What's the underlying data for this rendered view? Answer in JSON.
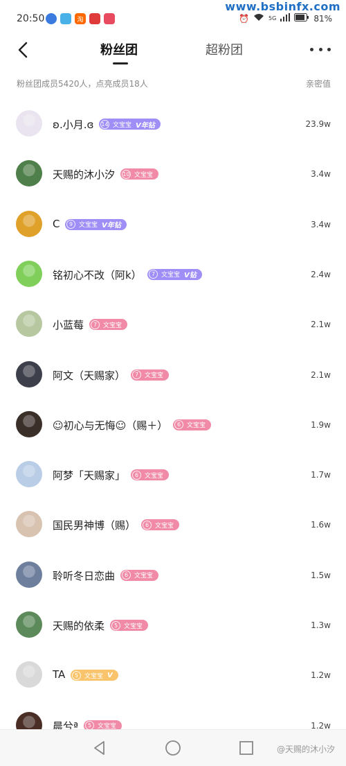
{
  "status_bar": {
    "time": "20:50",
    "network": "5G",
    "battery": "81%",
    "watermark": "www.bsbinfx.com",
    "app_labels": [
      "",
      "",
      "淘",
      "",
      ""
    ]
  },
  "header": {
    "tab_fans": "粉丝团",
    "tab_super": "超粉团"
  },
  "summary": {
    "text": "粉丝团成员5420人，点亮成员18人",
    "column_label": "亲密值"
  },
  "rows": [
    {
      "name": "ʚ.小月.ɞ",
      "level": "14",
      "badge": "文宝宝",
      "vtag": "V年钻",
      "color": "purple",
      "value": "23.9w"
    },
    {
      "name": "天赐的沐小汐",
      "level": "10",
      "badge": "文宝宝",
      "vtag": "",
      "color": "pink",
      "value": "3.4w"
    },
    {
      "name": "C",
      "level": "9",
      "badge": "文宝宝",
      "vtag": "V年钻",
      "color": "purple",
      "value": "3.4w"
    },
    {
      "name": "铭初心不改（阿k）",
      "level": "7",
      "badge": "文宝宝",
      "vtag": "V钻",
      "color": "purple",
      "value": "2.4w"
    },
    {
      "name": "小蓝莓",
      "level": "7",
      "badge": "文宝宝",
      "vtag": "",
      "color": "pink",
      "value": "2.1w"
    },
    {
      "name": "阿文（天赐家）",
      "level": "7",
      "badge": "文宝宝",
      "vtag": "",
      "color": "pink",
      "value": "2.1w"
    },
    {
      "name": "☺初心与无悔☺（赐＋）",
      "level": "6",
      "badge": "文宝宝",
      "vtag": "",
      "color": "pink",
      "value": "1.9w"
    },
    {
      "name": "阿梦「天赐家」",
      "level": "6",
      "badge": "文宝宝",
      "vtag": "",
      "color": "pink",
      "value": "1.7w"
    },
    {
      "name": "国民男神博（赐）",
      "level": "6",
      "badge": "文宝宝",
      "vtag": "",
      "color": "pink",
      "value": "1.6w"
    },
    {
      "name": "聆听冬日恋曲",
      "level": "6",
      "badge": "文宝宝",
      "vtag": "",
      "color": "pink",
      "value": "1.5w"
    },
    {
      "name": "天赐的依柔",
      "level": "5",
      "badge": "文宝宝",
      "vtag": "",
      "color": "pink",
      "value": "1.3w"
    },
    {
      "name": "TA",
      "level": "5",
      "badge": "文宝宝",
      "vtag": "V",
      "color": "orange",
      "value": "1.2w"
    },
    {
      "name": "晨兮ª",
      "level": "5",
      "badge": "文宝宝",
      "vtag": "",
      "color": "pink",
      "value": "1.2w"
    }
  ],
  "avatar_colors": [
    "#e9e4ef",
    "#4f7f4a",
    "#e0a12a",
    "#7fcf5a",
    "#b7c8a0",
    "#3d3f4a",
    "#3b2f2a",
    "#b9cde6",
    "#d8c2b0",
    "#6e7f9e",
    "#5c8a5a",
    "#d9d9d9",
    "#4a2e26"
  ],
  "watermark_bottom": "@天赐的沐小汐",
  "colors": {
    "badge_pink": "#f08aa6",
    "badge_purple": "#9f8ef5",
    "badge_orange": "#f9c46c"
  }
}
